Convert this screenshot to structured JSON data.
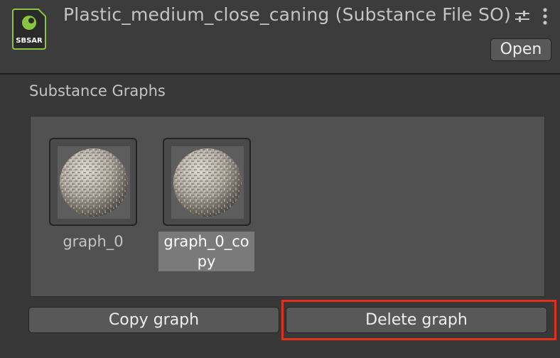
{
  "header": {
    "title": "Plastic_medium_close_caning (Substance File SO)",
    "file_icon": {
      "name": "sbsar-file-icon",
      "label": "SBSAR",
      "color": "#8bc53f"
    },
    "settings_icon": "sliders-icon",
    "menu_icon": "kebab-menu-icon",
    "open_label": "Open"
  },
  "section": {
    "title": "Substance Graphs"
  },
  "graphs": [
    {
      "label": "graph_0",
      "selected": false,
      "thumbnail": "woven-sphere-thumbnail"
    },
    {
      "label": "graph_0_copy",
      "label_line1": "graph_0_co",
      "label_line2": "py",
      "selected": true,
      "thumbnail": "woven-sphere-thumbnail"
    }
  ],
  "actions": {
    "copy_label": "Copy graph",
    "delete_label": "Delete graph",
    "highlight_color": "#e0301e"
  }
}
